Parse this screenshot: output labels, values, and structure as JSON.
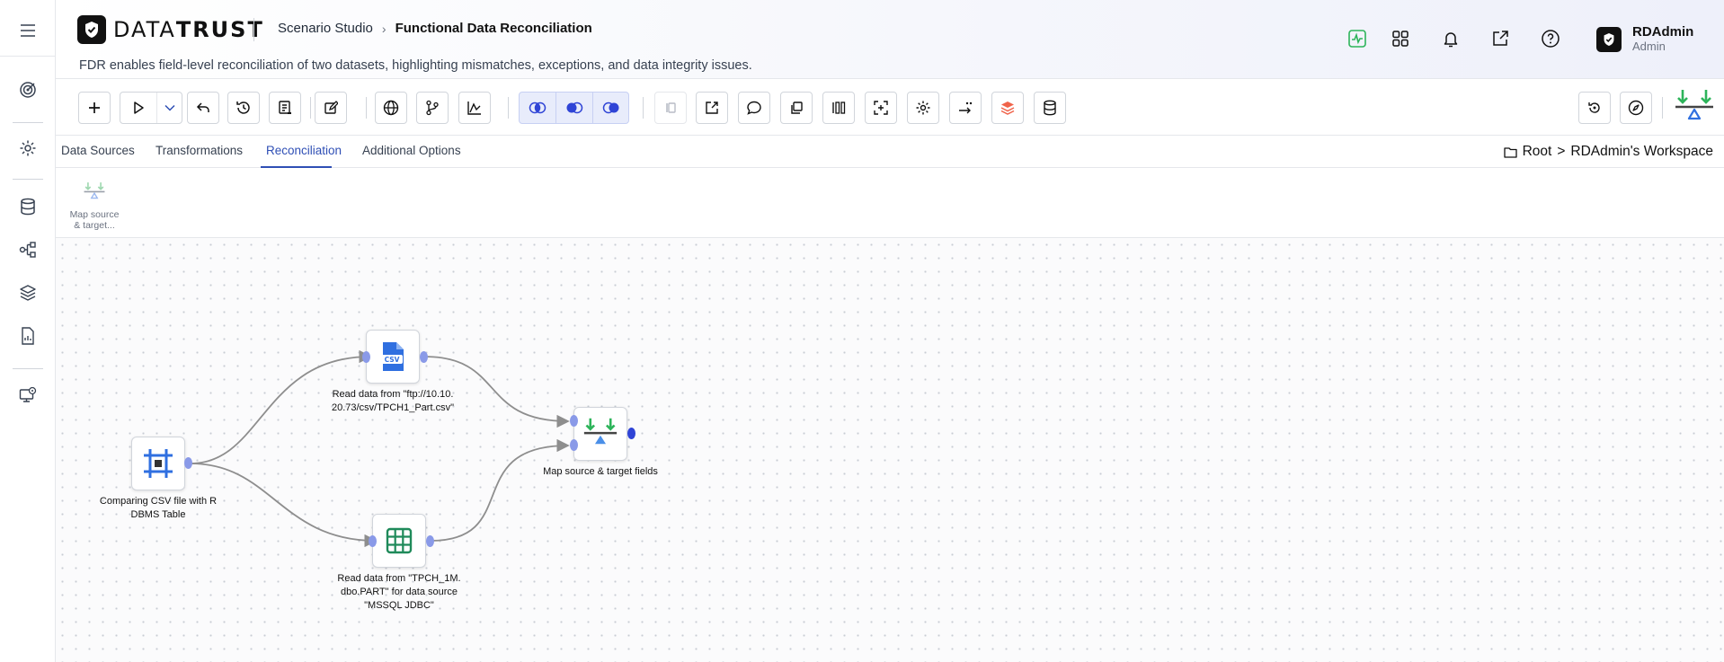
{
  "header": {
    "logo_text_light": "DATA",
    "logo_text_bold": "TRUST",
    "breadcrumb_parent": "Scenario Studio",
    "breadcrumb_current": "Functional Data Reconciliation",
    "subtitle": "FDR enables field-level reconciliation of two datasets, highlighting mismatches, exceptions, and data integrity issues.",
    "user_name": "RDAdmin",
    "user_role": "Admin"
  },
  "tabs": [
    {
      "label": "Data Sources"
    },
    {
      "label": "Transformations"
    },
    {
      "label": "Reconciliation",
      "active": true
    },
    {
      "label": "Additional Options"
    }
  ],
  "workspace": {
    "root": "Root",
    "separator": ">",
    "name": "RDAdmin's Workspace"
  },
  "palette": {
    "items": [
      {
        "label_line1": "Map source",
        "label_line2": "& target..."
      }
    ]
  },
  "nodes": {
    "source": {
      "label_line1": "Comparing CSV file with R",
      "label_line2": "DBMS Table"
    },
    "csv": {
      "label_line1": "Read data from \"ftp://10.10.",
      "label_line2": "20.73/csv/TPCH1_Part.csv\"",
      "badge": "CSV"
    },
    "db": {
      "label_line1": "Read data from \"TPCH_1M.",
      "label_line2": "dbo.PART\" for data source",
      "label_line3": "\"MSSQL JDBC\""
    },
    "map": {
      "label_line1": "Map source & target fields"
    }
  },
  "colors": {
    "accent": "#2f4fb5",
    "port": "#8a9ae8",
    "edge": "#8e8e8e",
    "green": "#2db45a"
  }
}
